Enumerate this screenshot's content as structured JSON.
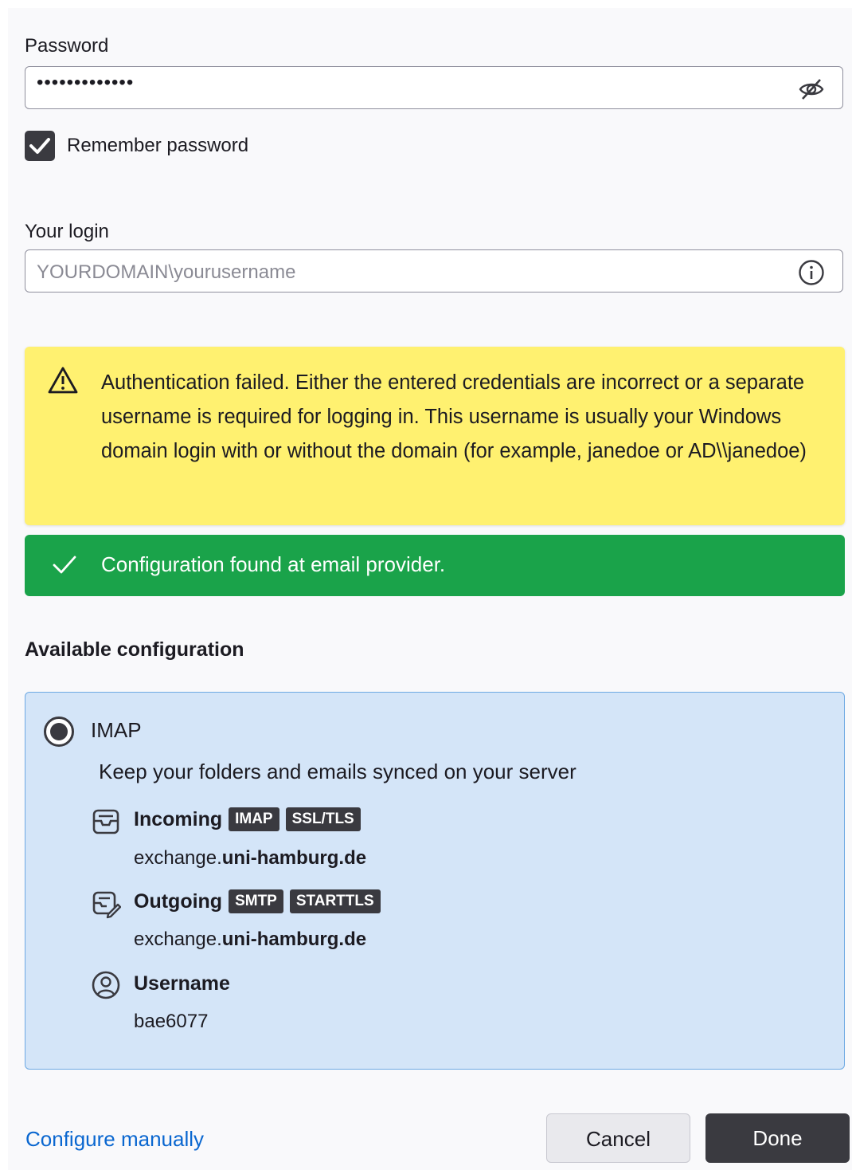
{
  "password": {
    "label": "Password",
    "value_masked": "•••••••••••••",
    "toggle_icon": "eye-slash-icon"
  },
  "remember": {
    "label": "Remember password",
    "checked": true
  },
  "login": {
    "label": "Your login",
    "placeholder": "YOURDOMAIN\\yourusername",
    "info_icon": "info-icon"
  },
  "warning": {
    "icon": "warning-icon",
    "message": "Authentication failed. Either the entered credentials are incorrect or a separate username is required for logging in. This username is usually your Windows domain login with or without the domain (for example, janedoe or AD\\\\janedoe)",
    "color": "#fff170"
  },
  "success": {
    "icon": "checkmark-icon",
    "message": "Configuration found at email provider.",
    "color": "#1aa34a"
  },
  "available": {
    "title": "Available configuration",
    "option": {
      "protocol": "IMAP",
      "selected": true,
      "description": "Keep your folders and emails synced on your server",
      "incoming": {
        "title": "Incoming",
        "badges": [
          "IMAP",
          "SSL/TLS"
        ],
        "host_prefix": "exchange.",
        "host_domain": "uni-hamburg.de"
      },
      "outgoing": {
        "title": "Outgoing",
        "badges": [
          "SMTP",
          "STARTTLS"
        ],
        "host_prefix": "exchange.",
        "host_domain": "uni-hamburg.de"
      },
      "username": {
        "title": "Username",
        "value": "bae6077"
      }
    }
  },
  "footer": {
    "configure_manually": "Configure manually",
    "cancel": "Cancel",
    "done": "Done"
  }
}
